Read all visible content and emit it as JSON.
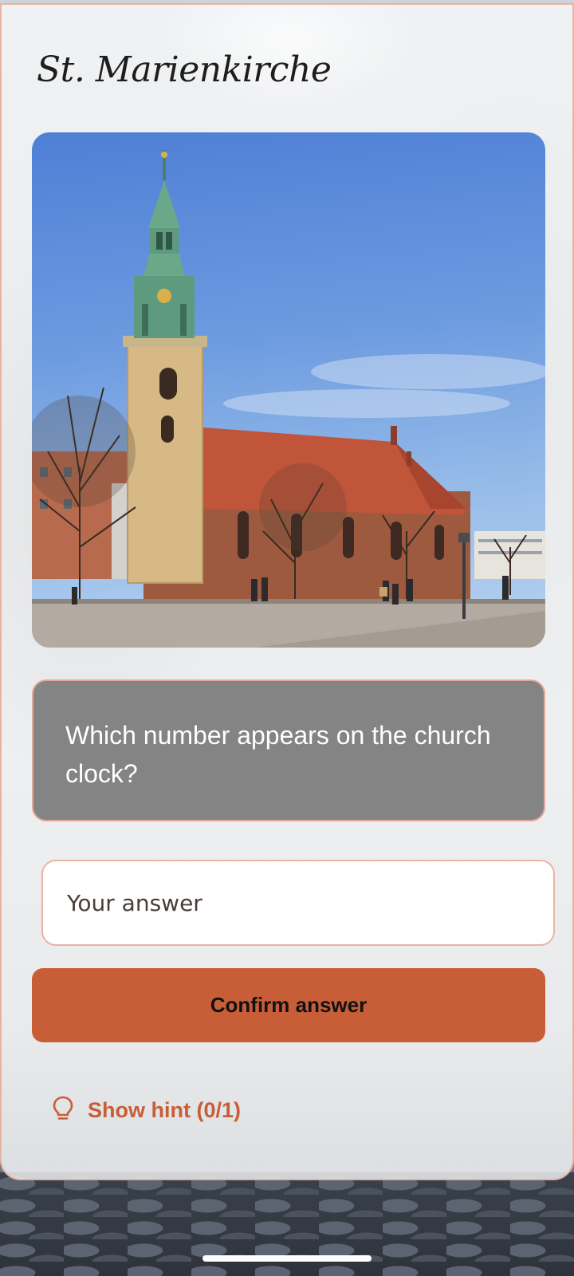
{
  "header": {
    "title": "St. Marienkirche"
  },
  "photo": {
    "subject": "church-photo"
  },
  "question": {
    "text": "Which number appears on the church clock?"
  },
  "answer": {
    "placeholder": "Your answer",
    "value": ""
  },
  "actions": {
    "confirm_label": "Confirm answer"
  },
  "hint": {
    "label": "Show hint (0/1)",
    "icon": "lightbulb-icon"
  },
  "colors": {
    "accent": "#c75e37",
    "question_bg": "#848484",
    "border": "#e7b3a3",
    "sky": "#6d9be0",
    "roof": "#c0553a"
  }
}
